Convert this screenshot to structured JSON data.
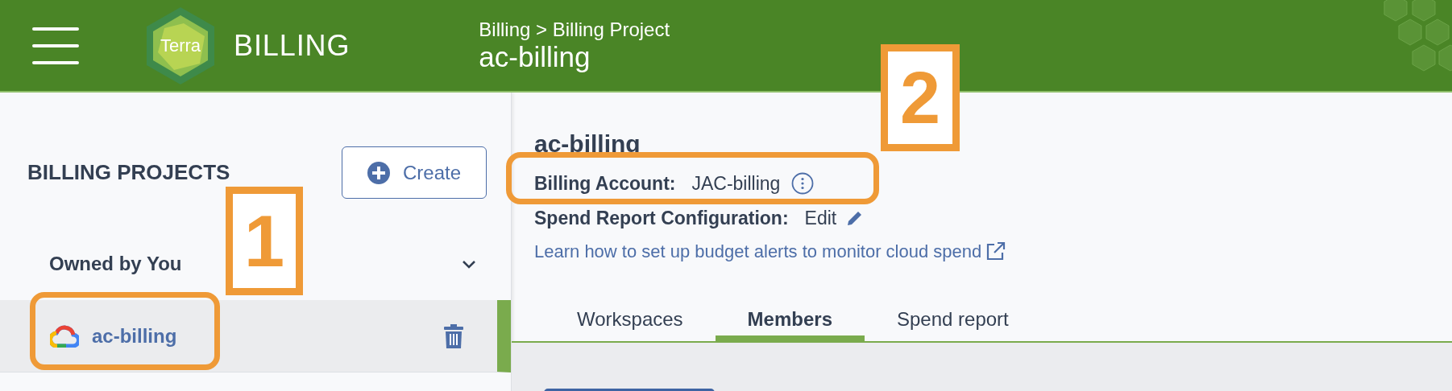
{
  "header": {
    "logo_text": "Terra",
    "app_title": "BILLING",
    "breadcrumb": "Billing > Billing Project",
    "title": "ac-billing"
  },
  "sidebar": {
    "heading": "BILLING PROJECTS",
    "create_button": "Create",
    "groups": [
      {
        "label": "Owned by You",
        "expanded": true,
        "projects": [
          {
            "name": "ac-billing",
            "selected": true
          }
        ]
      }
    ]
  },
  "main": {
    "title": "ac-billing",
    "billing_account": {
      "label": "Billing Account:",
      "value": "JAC-billing"
    },
    "spend_report": {
      "label": "Spend Report Configuration:",
      "action": "Edit"
    },
    "link": "Learn how to set up budget alerts to monitor cloud spend",
    "tabs": [
      {
        "label": "Workspaces",
        "selected": false
      },
      {
        "label": "Members",
        "selected": true
      },
      {
        "label": "Spend report",
        "selected": false
      }
    ]
  },
  "annotations": [
    {
      "label": "1"
    },
    {
      "label": "2"
    }
  ]
}
